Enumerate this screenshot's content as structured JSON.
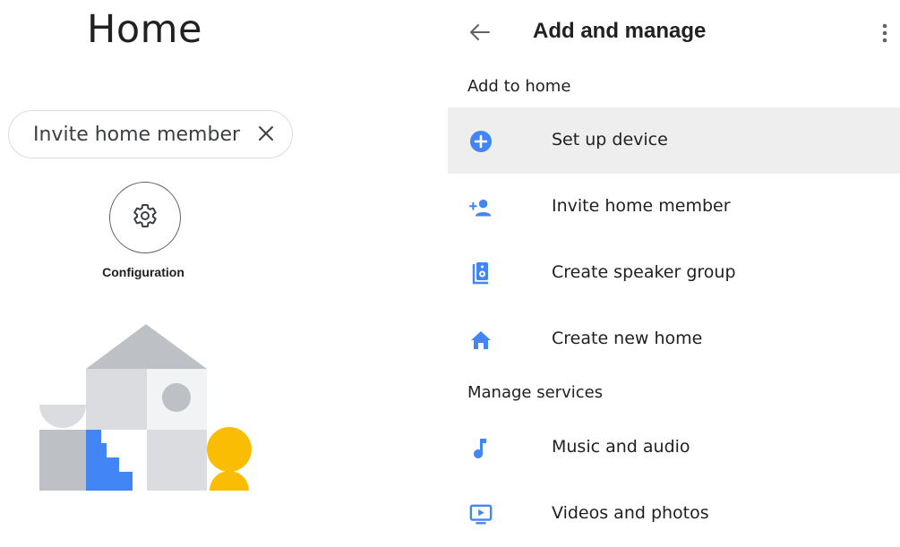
{
  "left": {
    "title": "Home",
    "chip": {
      "label": "Invite home member"
    },
    "configuration": {
      "label": "Configuration"
    }
  },
  "right": {
    "title": "Add and manage",
    "sections": [
      {
        "header": "Add to home",
        "items": [
          {
            "label": "Set up device",
            "icon": "add-circle-icon"
          },
          {
            "label": "Invite home member",
            "icon": "person-add-icon"
          },
          {
            "label": "Create speaker group",
            "icon": "speaker-icon"
          },
          {
            "label": "Create new home",
            "icon": "home-icon"
          }
        ]
      },
      {
        "header": "Manage services",
        "items": [
          {
            "label": "Music and audio",
            "icon": "music-note-icon"
          },
          {
            "label": "Videos and photos",
            "icon": "video-screen-icon"
          }
        ]
      }
    ]
  },
  "colors": {
    "accent": "#4285f4",
    "highlight": "#eeeeee",
    "yellow": "#fbbc04",
    "gray_light": "#dadce0",
    "gray_mid": "#bdc1c6"
  }
}
